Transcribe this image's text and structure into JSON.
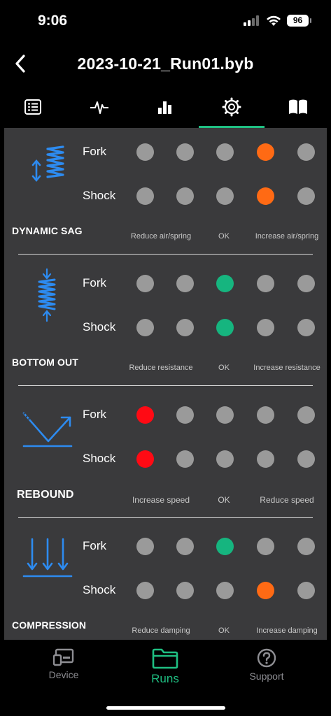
{
  "status": {
    "time": "9:06",
    "battery": "96"
  },
  "header": {
    "title": "2023-10-21_Run01.byb"
  },
  "tabs": [
    {
      "name": "list",
      "icon": "list-icon"
    },
    {
      "name": "activity",
      "icon": "pulse-icon"
    },
    {
      "name": "stats",
      "icon": "bar-chart-icon"
    },
    {
      "name": "settings",
      "icon": "gear-icon",
      "active": true
    },
    {
      "name": "guide",
      "icon": "book-icon"
    }
  ],
  "colors": {
    "accent": "#1fbf82",
    "orange": "#ff6a14",
    "green": "#16b57f",
    "red": "#ff0a14",
    "neutral": "#9a9a9a"
  },
  "sections": [
    {
      "title": "DYNAMIC SAG",
      "fork_label": "Fork",
      "shock_label": "Shock",
      "fork_state": [
        "neutral",
        "neutral",
        "neutral",
        "orange",
        "neutral"
      ],
      "shock_state": [
        "neutral",
        "neutral",
        "neutral",
        "orange",
        "neutral"
      ],
      "scale": {
        "left": "Reduce air/spring",
        "mid": "OK",
        "right": "Increase air/spring"
      }
    },
    {
      "title": "BOTTOM OUT",
      "fork_label": "Fork",
      "shock_label": "Shock",
      "fork_state": [
        "neutral",
        "neutral",
        "green",
        "neutral",
        "neutral"
      ],
      "shock_state": [
        "neutral",
        "neutral",
        "green",
        "neutral",
        "neutral"
      ],
      "scale": {
        "left": "Reduce resistance",
        "mid": "OK",
        "right": "Increase resistance"
      }
    },
    {
      "title": "REBOUND",
      "fork_label": "Fork",
      "shock_label": "Shock",
      "fork_state": [
        "red",
        "neutral",
        "neutral",
        "neutral",
        "neutral"
      ],
      "shock_state": [
        "red",
        "neutral",
        "neutral",
        "neutral",
        "neutral"
      ],
      "scale": {
        "left": "Increase speed",
        "mid": "OK",
        "right": "Reduce speed"
      }
    },
    {
      "title": "COMPRESSION",
      "fork_label": "Fork",
      "shock_label": "Shock",
      "fork_state": [
        "neutral",
        "neutral",
        "green",
        "neutral",
        "neutral"
      ],
      "shock_state": [
        "neutral",
        "neutral",
        "neutral",
        "orange",
        "neutral"
      ],
      "scale": {
        "left": "Reduce damping",
        "mid": "OK",
        "right": "Increase damping"
      }
    }
  ],
  "bottom_nav": {
    "device": "Device",
    "runs": "Runs",
    "support": "Support"
  }
}
